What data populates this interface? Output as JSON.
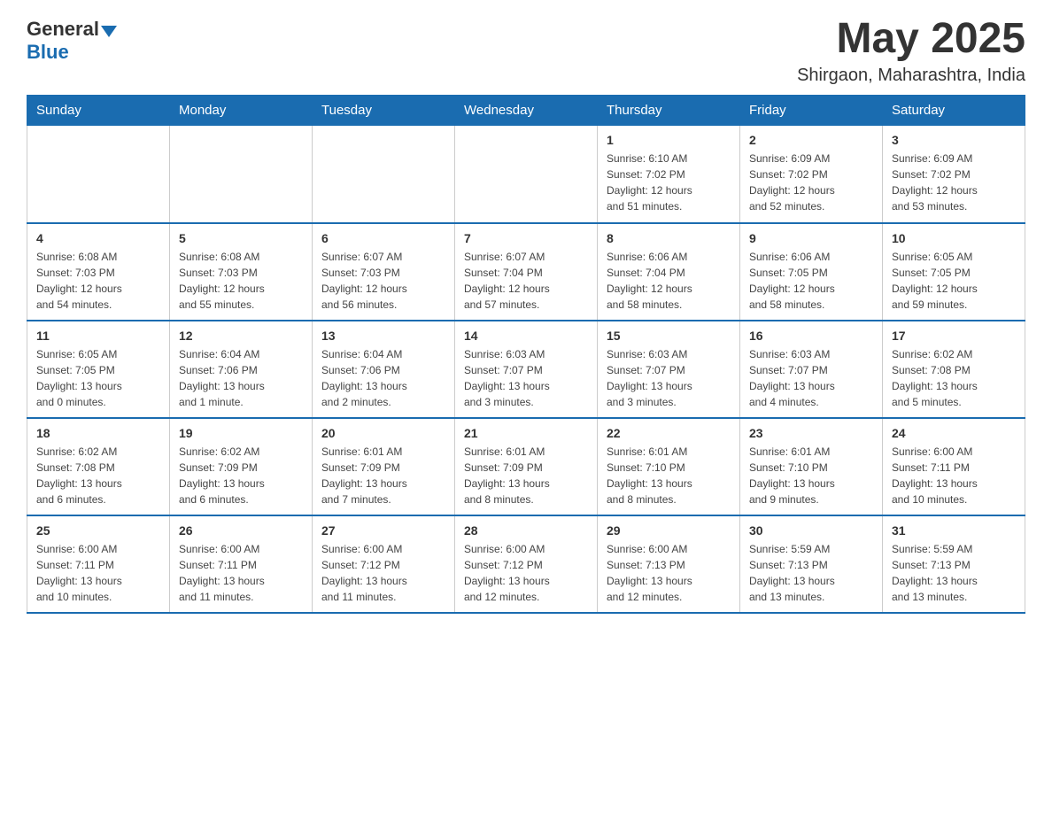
{
  "header": {
    "logo_general": "General",
    "logo_blue": "Blue",
    "month_title": "May 2025",
    "location": "Shirgaon, Maharashtra, India"
  },
  "weekdays": [
    "Sunday",
    "Monday",
    "Tuesday",
    "Wednesday",
    "Thursday",
    "Friday",
    "Saturday"
  ],
  "weeks": [
    [
      {
        "day": "",
        "info": ""
      },
      {
        "day": "",
        "info": ""
      },
      {
        "day": "",
        "info": ""
      },
      {
        "day": "",
        "info": ""
      },
      {
        "day": "1",
        "info": "Sunrise: 6:10 AM\nSunset: 7:02 PM\nDaylight: 12 hours\nand 51 minutes."
      },
      {
        "day": "2",
        "info": "Sunrise: 6:09 AM\nSunset: 7:02 PM\nDaylight: 12 hours\nand 52 minutes."
      },
      {
        "day": "3",
        "info": "Sunrise: 6:09 AM\nSunset: 7:02 PM\nDaylight: 12 hours\nand 53 minutes."
      }
    ],
    [
      {
        "day": "4",
        "info": "Sunrise: 6:08 AM\nSunset: 7:03 PM\nDaylight: 12 hours\nand 54 minutes."
      },
      {
        "day": "5",
        "info": "Sunrise: 6:08 AM\nSunset: 7:03 PM\nDaylight: 12 hours\nand 55 minutes."
      },
      {
        "day": "6",
        "info": "Sunrise: 6:07 AM\nSunset: 7:03 PM\nDaylight: 12 hours\nand 56 minutes."
      },
      {
        "day": "7",
        "info": "Sunrise: 6:07 AM\nSunset: 7:04 PM\nDaylight: 12 hours\nand 57 minutes."
      },
      {
        "day": "8",
        "info": "Sunrise: 6:06 AM\nSunset: 7:04 PM\nDaylight: 12 hours\nand 58 minutes."
      },
      {
        "day": "9",
        "info": "Sunrise: 6:06 AM\nSunset: 7:05 PM\nDaylight: 12 hours\nand 58 minutes."
      },
      {
        "day": "10",
        "info": "Sunrise: 6:05 AM\nSunset: 7:05 PM\nDaylight: 12 hours\nand 59 minutes."
      }
    ],
    [
      {
        "day": "11",
        "info": "Sunrise: 6:05 AM\nSunset: 7:05 PM\nDaylight: 13 hours\nand 0 minutes."
      },
      {
        "day": "12",
        "info": "Sunrise: 6:04 AM\nSunset: 7:06 PM\nDaylight: 13 hours\nand 1 minute."
      },
      {
        "day": "13",
        "info": "Sunrise: 6:04 AM\nSunset: 7:06 PM\nDaylight: 13 hours\nand 2 minutes."
      },
      {
        "day": "14",
        "info": "Sunrise: 6:03 AM\nSunset: 7:07 PM\nDaylight: 13 hours\nand 3 minutes."
      },
      {
        "day": "15",
        "info": "Sunrise: 6:03 AM\nSunset: 7:07 PM\nDaylight: 13 hours\nand 3 minutes."
      },
      {
        "day": "16",
        "info": "Sunrise: 6:03 AM\nSunset: 7:07 PM\nDaylight: 13 hours\nand 4 minutes."
      },
      {
        "day": "17",
        "info": "Sunrise: 6:02 AM\nSunset: 7:08 PM\nDaylight: 13 hours\nand 5 minutes."
      }
    ],
    [
      {
        "day": "18",
        "info": "Sunrise: 6:02 AM\nSunset: 7:08 PM\nDaylight: 13 hours\nand 6 minutes."
      },
      {
        "day": "19",
        "info": "Sunrise: 6:02 AM\nSunset: 7:09 PM\nDaylight: 13 hours\nand 6 minutes."
      },
      {
        "day": "20",
        "info": "Sunrise: 6:01 AM\nSunset: 7:09 PM\nDaylight: 13 hours\nand 7 minutes."
      },
      {
        "day": "21",
        "info": "Sunrise: 6:01 AM\nSunset: 7:09 PM\nDaylight: 13 hours\nand 8 minutes."
      },
      {
        "day": "22",
        "info": "Sunrise: 6:01 AM\nSunset: 7:10 PM\nDaylight: 13 hours\nand 8 minutes."
      },
      {
        "day": "23",
        "info": "Sunrise: 6:01 AM\nSunset: 7:10 PM\nDaylight: 13 hours\nand 9 minutes."
      },
      {
        "day": "24",
        "info": "Sunrise: 6:00 AM\nSunset: 7:11 PM\nDaylight: 13 hours\nand 10 minutes."
      }
    ],
    [
      {
        "day": "25",
        "info": "Sunrise: 6:00 AM\nSunset: 7:11 PM\nDaylight: 13 hours\nand 10 minutes."
      },
      {
        "day": "26",
        "info": "Sunrise: 6:00 AM\nSunset: 7:11 PM\nDaylight: 13 hours\nand 11 minutes."
      },
      {
        "day": "27",
        "info": "Sunrise: 6:00 AM\nSunset: 7:12 PM\nDaylight: 13 hours\nand 11 minutes."
      },
      {
        "day": "28",
        "info": "Sunrise: 6:00 AM\nSunset: 7:12 PM\nDaylight: 13 hours\nand 12 minutes."
      },
      {
        "day": "29",
        "info": "Sunrise: 6:00 AM\nSunset: 7:13 PM\nDaylight: 13 hours\nand 12 minutes."
      },
      {
        "day": "30",
        "info": "Sunrise: 5:59 AM\nSunset: 7:13 PM\nDaylight: 13 hours\nand 13 minutes."
      },
      {
        "day": "31",
        "info": "Sunrise: 5:59 AM\nSunset: 7:13 PM\nDaylight: 13 hours\nand 13 minutes."
      }
    ]
  ]
}
